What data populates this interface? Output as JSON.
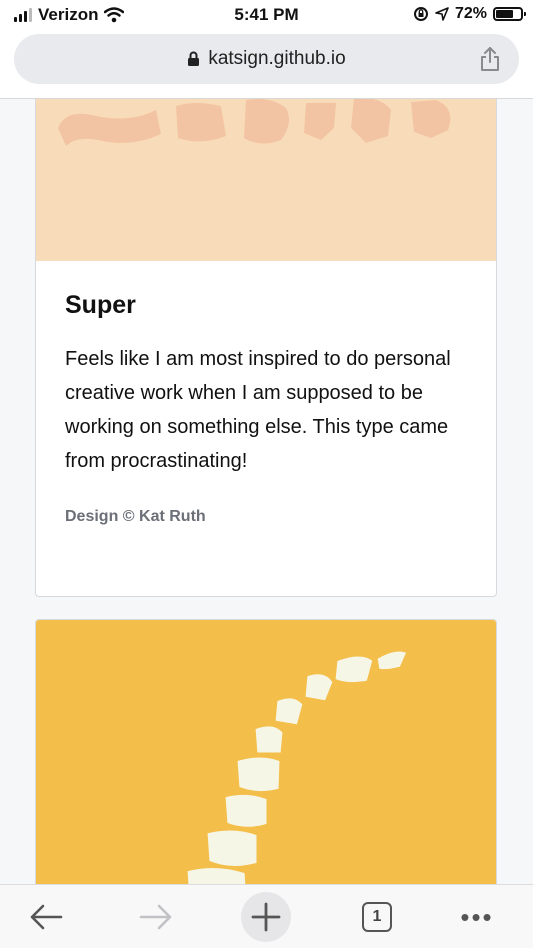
{
  "status_bar": {
    "carrier": "Verizon",
    "time": "5:41 PM",
    "battery_percent": "72%",
    "battery_level": 0.72,
    "icons": [
      "signal-icon",
      "wifi-icon",
      "rotation-lock-icon",
      "location-arrow-icon",
      "battery-icon"
    ]
  },
  "browser": {
    "url": "katsign.github.io",
    "icons": [
      "lock-icon",
      "share-icon"
    ],
    "open_tabs": "1"
  },
  "cards": [
    {
      "title": "Super",
      "description": "Feels like I am most inspired to do personal creative work when I am supposed to be working on something else. This type came from procrastinating!",
      "credit": "Design © Kat Ruth",
      "art_color": "#f8dcb9",
      "art_shape_color": "#f3c4a3"
    },
    {
      "art_color": "#f3be4a",
      "art_shape_color": "#f6f6e6"
    }
  ],
  "toolbar": {
    "icons": [
      "back-arrow-icon",
      "forward-arrow-icon",
      "plus-icon",
      "tab-count-icon",
      "more-dots-icon"
    ],
    "more_label": "•••"
  }
}
